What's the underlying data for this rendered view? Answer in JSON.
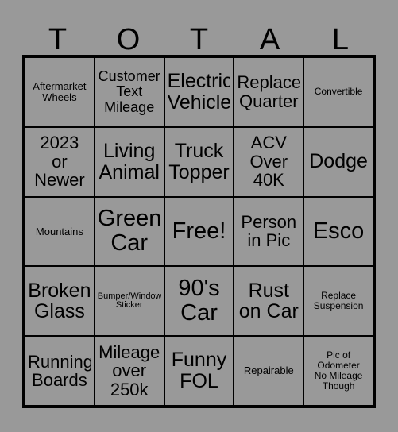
{
  "card": {
    "title_letters": [
      "T",
      "O",
      "T",
      "A",
      "L"
    ],
    "background_color": "#999999",
    "border_color": "#000000",
    "text_color": "#000000",
    "columns": 5,
    "rows": 5,
    "cells": [
      {
        "text": "Aftermarket\nWheels",
        "size": "sm",
        "free": false
      },
      {
        "text": "Customer\nText\nMileage",
        "size": "md",
        "free": false
      },
      {
        "text": "Electric\nVehicle",
        "size": "xl",
        "free": false
      },
      {
        "text": "Replace\nQuarter",
        "size": "lg",
        "free": false
      },
      {
        "text": "Convertible",
        "size": "xs",
        "free": false
      },
      {
        "text": "2023\nor\nNewer",
        "size": "lg",
        "free": false
      },
      {
        "text": "Living\nAnimal",
        "size": "xl",
        "free": false
      },
      {
        "text": "Truck\nTopper",
        "size": "xl",
        "free": false
      },
      {
        "text": "ACV\nOver\n40K",
        "size": "lg",
        "free": false
      },
      {
        "text": "Dodge",
        "size": "xl",
        "free": false
      },
      {
        "text": "Mountains",
        "size": "sm",
        "free": false
      },
      {
        "text": "Green\nCar",
        "size": "xxl",
        "free": false
      },
      {
        "text": "Free!",
        "size": "xxl",
        "free": true
      },
      {
        "text": "Person\nin Pic",
        "size": "lg",
        "free": false
      },
      {
        "text": "Esco",
        "size": "xxl",
        "free": false
      },
      {
        "text": "Broken\nGlass",
        "size": "xl",
        "free": false
      },
      {
        "text": "Bumper/Window\nSticker",
        "size": "xxs",
        "free": false
      },
      {
        "text": "90's\nCar",
        "size": "xxl",
        "free": false
      },
      {
        "text": "Rust\non Car",
        "size": "xl",
        "free": false
      },
      {
        "text": "Replace\nSuspension",
        "size": "xs",
        "free": false
      },
      {
        "text": "Running\nBoards",
        "size": "lg",
        "free": false
      },
      {
        "text": "Mileage\nover\n250k",
        "size": "lg",
        "free": false
      },
      {
        "text": "Funny\nFOL",
        "size": "xl",
        "free": false
      },
      {
        "text": "Repairable",
        "size": "sm",
        "free": false
      },
      {
        "text": "Pic of\nOdometer\nNo Mileage\nThough",
        "size": "xs",
        "free": false
      }
    ]
  }
}
